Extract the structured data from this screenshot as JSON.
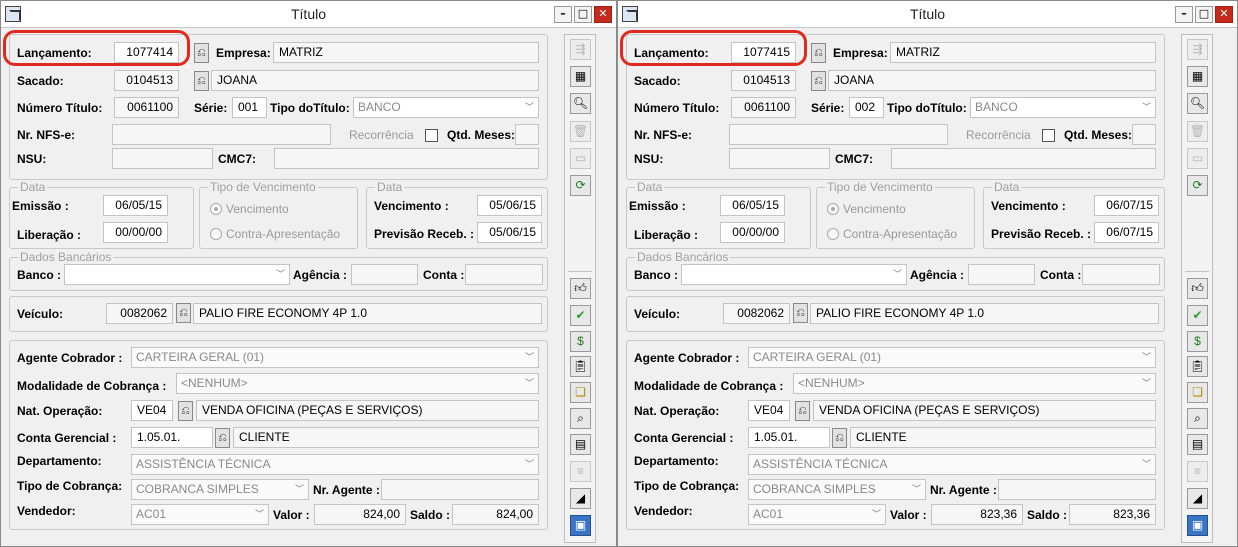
{
  "windows": [
    {
      "title": "Título",
      "lancamento_label": "Lançamento:",
      "lancamento": "1077414",
      "empresa_label": "Empresa:",
      "empresa": "MATRIZ",
      "sacado_label": "Sacado:",
      "sacado_code": "0104513",
      "sacado_name": "JOANA",
      "numero_titulo_label": "Número Título:",
      "numero_titulo": "0061100",
      "serie_label": "Série:",
      "serie": "001",
      "tipo_titulo_label": "Tipo doTítulo:",
      "tipo_titulo": "BANCO",
      "nfse_label": "Nr. NFS-e:",
      "nfse": "",
      "recorrencia_label": "Recorrência",
      "qtd_meses_label": "Qtd. Meses:",
      "qtd_meses": "",
      "nsu_label": "NSU:",
      "nsu": "",
      "cmc7_label": "CMC7:",
      "cmc7": "",
      "data_legend": "Data",
      "emissao_label": "Emissão :",
      "emissao": "06/05/15",
      "liberacao_label": "Liberação :",
      "liberacao": "00/00/00",
      "tipo_venc_legend": "Tipo de Vencimento",
      "radio_vencimento": "Vencimento",
      "radio_contra": "Contra-Apresentação",
      "data2_legend": "Data",
      "vencimento_label": "Vencimento :",
      "vencimento": "05/06/15",
      "previsao_label": "Previsão Receb. :",
      "previsao": "05/06/15",
      "dados_bancarios_legend": "Dados Bancários",
      "banco_label": "Banco :",
      "banco": "",
      "agencia_label": "Agência :",
      "agencia": "",
      "conta_label": "Conta :",
      "conta": "",
      "veiculo_label": "Veículo:",
      "veiculo_code": "0082062",
      "veiculo_name": "PALIO FIRE ECONOMY 4P 1.0",
      "agente_label": "Agente Cobrador :",
      "agente": "CARTEIRA GERAL (01)",
      "modalidade_label": "Modalidade de Cobrança :",
      "modalidade": "<NENHUM>",
      "nat_operacao_label": "Nat. Operação:",
      "nat_code": "VE04",
      "nat_name": "VENDA OFICINA (PEÇAS E SERVIÇOS)",
      "conta_ger_label": "Conta Gerencial :",
      "conta_ger_code": "1.05.01.",
      "conta_ger_name": "CLIENTE",
      "departamento_label": "Departamento:",
      "departamento": "ASSISTÊNCIA TÉCNICA",
      "tipo_cobranca_label": "Tipo de Cobrança:",
      "tipo_cobranca": "COBRANCA SIMPLES",
      "nr_agente_label": "Nr. Agente :",
      "nr_agente": "",
      "vendedor_label": "Vendedor:",
      "vendedor": "AC01",
      "valor_label": "Valor :",
      "valor": "824,00",
      "saldo_label": "Saldo :",
      "saldo": "824,00"
    },
    {
      "title": "Título",
      "lancamento_label": "Lançamento:",
      "lancamento": "1077415",
      "empresa_label": "Empresa:",
      "empresa": "MATRIZ",
      "sacado_label": "Sacado:",
      "sacado_code": "0104513",
      "sacado_name": "JOANA",
      "numero_titulo_label": "Número Título:",
      "numero_titulo": "0061100",
      "serie_label": "Série:",
      "serie": "002",
      "tipo_titulo_label": "Tipo doTítulo:",
      "tipo_titulo": "BANCO",
      "nfse_label": "Nr. NFS-e:",
      "nfse": "",
      "recorrencia_label": "Recorrência",
      "qtd_meses_label": "Qtd. Meses:",
      "qtd_meses": "",
      "nsu_label": "NSU:",
      "nsu": "",
      "cmc7_label": "CMC7:",
      "cmc7": "",
      "data_legend": "Data",
      "emissao_label": "Emissão :",
      "emissao": "06/05/15",
      "liberacao_label": "Liberação :",
      "liberacao": "00/00/00",
      "tipo_venc_legend": "Tipo de Vencimento",
      "radio_vencimento": "Vencimento",
      "radio_contra": "Contra-Apresentação",
      "data2_legend": "Data",
      "vencimento_label": "Vencimento :",
      "vencimento": "06/07/15",
      "previsao_label": "Previsão Receb. :",
      "previsao": "06/07/15",
      "dados_bancarios_legend": "Dados Bancários",
      "banco_label": "Banco :",
      "banco": "",
      "agencia_label": "Agência :",
      "agencia": "",
      "conta_label": "Conta :",
      "conta": "",
      "veiculo_label": "Veículo:",
      "veiculo_code": "0082062",
      "veiculo_name": "PALIO FIRE ECONOMY 4P 1.0",
      "agente_label": "Agente Cobrador :",
      "agente": "CARTEIRA GERAL (01)",
      "modalidade_label": "Modalidade de Cobrança :",
      "modalidade": "<NENHUM>",
      "nat_operacao_label": "Nat. Operação:",
      "nat_code": "VE04",
      "nat_name": "VENDA OFICINA (PEÇAS E SERVIÇOS)",
      "conta_ger_label": "Conta Gerencial :",
      "conta_ger_code": "1.05.01.",
      "conta_ger_name": "CLIENTE",
      "departamento_label": "Departamento:",
      "departamento": "ASSISTÊNCIA TÉCNICA",
      "tipo_cobranca_label": "Tipo de Cobrança:",
      "tipo_cobranca": "COBRANCA SIMPLES",
      "nr_agente_label": "Nr. Agente :",
      "nr_agente": "",
      "vendedor_label": "Vendedor:",
      "vendedor": "AC01",
      "valor_label": "Valor :",
      "valor": "823,36",
      "saldo_label": "Saldo :",
      "saldo": "823,36"
    }
  ],
  "toolbar_icons": [
    "columns-icon",
    "spreadsheet-icon",
    "preview-icon",
    "trash-icon",
    "folder-open-icon",
    "refresh-icon",
    "thumbs-up-icon",
    "checkmark-icon",
    "money-bag-icon",
    "clipboard-icon",
    "stack-icon",
    "search-doc-icon",
    "document-icon",
    "list-icon",
    "chart-icon",
    "calculator-icon"
  ],
  "highlight_color": "#e02a20"
}
